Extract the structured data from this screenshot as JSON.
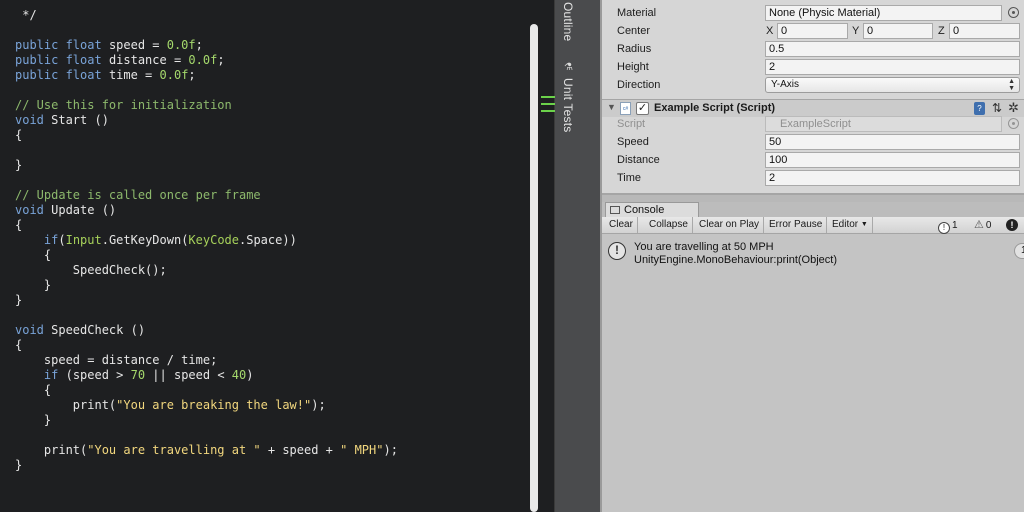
{
  "editor": {
    "lines": [
      [
        {
          "t": " */",
          "c": "plain"
        }
      ],
      [],
      [
        {
          "t": "public ",
          "c": "kw"
        },
        {
          "t": "float ",
          "c": "kw"
        },
        {
          "t": "speed = ",
          "c": "plain"
        },
        {
          "t": "0.0f",
          "c": "num"
        },
        {
          "t": ";",
          "c": "plain"
        }
      ],
      [
        {
          "t": "public ",
          "c": "kw"
        },
        {
          "t": "float ",
          "c": "kw"
        },
        {
          "t": "distance = ",
          "c": "plain"
        },
        {
          "t": "0.0f",
          "c": "num"
        },
        {
          "t": ";",
          "c": "plain"
        }
      ],
      [
        {
          "t": "public ",
          "c": "kw"
        },
        {
          "t": "float ",
          "c": "kw"
        },
        {
          "t": "time = ",
          "c": "plain"
        },
        {
          "t": "0.0f",
          "c": "num"
        },
        {
          "t": ";",
          "c": "plain"
        }
      ],
      [],
      [
        {
          "t": "// Use this for initialization",
          "c": "cm"
        }
      ],
      [
        {
          "t": "void ",
          "c": "kw"
        },
        {
          "t": "Start ()",
          "c": "plain"
        }
      ],
      [
        {
          "t": "{",
          "c": "plain"
        }
      ],
      [],
      [
        {
          "t": "}",
          "c": "plain"
        }
      ],
      [],
      [
        {
          "t": "// Update is called once per frame",
          "c": "cm"
        }
      ],
      [
        {
          "t": "void ",
          "c": "kw"
        },
        {
          "t": "Update ()",
          "c": "plain"
        }
      ],
      [
        {
          "t": "{",
          "c": "plain"
        }
      ],
      [
        {
          "t": "    ",
          "c": "plain"
        },
        {
          "t": "if",
          "c": "kw"
        },
        {
          "t": "(",
          "c": "plain"
        },
        {
          "t": "Input",
          "c": "type"
        },
        {
          "t": ".GetKeyDown(",
          "c": "plain"
        },
        {
          "t": "KeyCode",
          "c": "type"
        },
        {
          "t": ".Space))",
          "c": "plain"
        }
      ],
      [
        {
          "t": "    {",
          "c": "plain"
        }
      ],
      [
        {
          "t": "        SpeedCheck();",
          "c": "plain"
        }
      ],
      [
        {
          "t": "    }",
          "c": "plain"
        }
      ],
      [
        {
          "t": "}",
          "c": "plain"
        }
      ],
      [],
      [
        {
          "t": "void ",
          "c": "kw"
        },
        {
          "t": "SpeedCheck ()",
          "c": "plain"
        }
      ],
      [
        {
          "t": "{",
          "c": "plain"
        }
      ],
      [
        {
          "t": "    speed = distance / time;",
          "c": "plain"
        }
      ],
      [
        {
          "t": "    ",
          "c": "plain"
        },
        {
          "t": "if ",
          "c": "kw"
        },
        {
          "t": "(speed > ",
          "c": "plain"
        },
        {
          "t": "70",
          "c": "num"
        },
        {
          "t": " || speed < ",
          "c": "plain"
        },
        {
          "t": "40",
          "c": "num"
        },
        {
          "t": ")",
          "c": "plain"
        }
      ],
      [
        {
          "t": "    {",
          "c": "plain"
        }
      ],
      [
        {
          "t": "        print(",
          "c": "plain"
        },
        {
          "t": "\"You are breaking the law!\"",
          "c": "str"
        },
        {
          "t": ");",
          "c": "plain"
        }
      ],
      [
        {
          "t": "    }",
          "c": "plain"
        }
      ],
      [],
      [
        {
          "t": "    print(",
          "c": "plain"
        },
        {
          "t": "\"You are travelling at \"",
          "c": "str"
        },
        {
          "t": " + speed + ",
          "c": "plain"
        },
        {
          "t": "\" MPH\"",
          "c": "str"
        },
        {
          "t": ");",
          "c": "plain"
        }
      ],
      [
        {
          "t": "}",
          "c": "plain"
        }
      ]
    ]
  },
  "dock": {
    "outline_label": "Outline",
    "unit_tests_label": "Unit Tests",
    "flask_icon": "⚗"
  },
  "collider": {
    "material_label": "Material",
    "material_value": "None (Physic Material)",
    "center_label": "Center",
    "center_x_label": "X",
    "center_x": "0",
    "center_y_label": "Y",
    "center_y": "0",
    "center_z_label": "Z",
    "center_z": "0",
    "radius_label": "Radius",
    "radius_value": "0.5",
    "height_label": "Height",
    "height_value": "2",
    "direction_label": "Direction",
    "direction_value": "Y-Axis"
  },
  "script_component": {
    "fold_glyph": "▼",
    "file_icon": "c#",
    "check_glyph": "✓",
    "title": "Example Script (Script)",
    "book_glyph": "?",
    "preset_glyph": "⇅",
    "gear_glyph": "✲",
    "script_label": "Script",
    "script_value": "ExampleScript",
    "speed_label": "Speed",
    "speed_value": "50",
    "distance_label": "Distance",
    "distance_value": "100",
    "time_label": "Time",
    "time_value": "2"
  },
  "console": {
    "tab_label": "Console",
    "toolbar": {
      "clear": "Clear",
      "collapse": "Collapse",
      "clear_on_play": "Clear on Play",
      "error_pause": "Error Pause",
      "editor": "Editor",
      "editor_arrow": "▼",
      "info_count": "1",
      "warn_count": "0",
      "error_glyph": "!"
    },
    "log_icon_glyph": "!",
    "entry_line1": "You are travelling at 50 MPH",
    "entry_line2": "UnityEngine.MonoBehaviour:print(Object)",
    "entry_count": "1"
  },
  "colors": {
    "editor_bg": "#1e1f21",
    "keyword": "#79a3d8",
    "number": "#a5d96c",
    "comment": "#8db96c",
    "string": "#f2d77e",
    "inspector_bg": "#d6d6d6"
  }
}
